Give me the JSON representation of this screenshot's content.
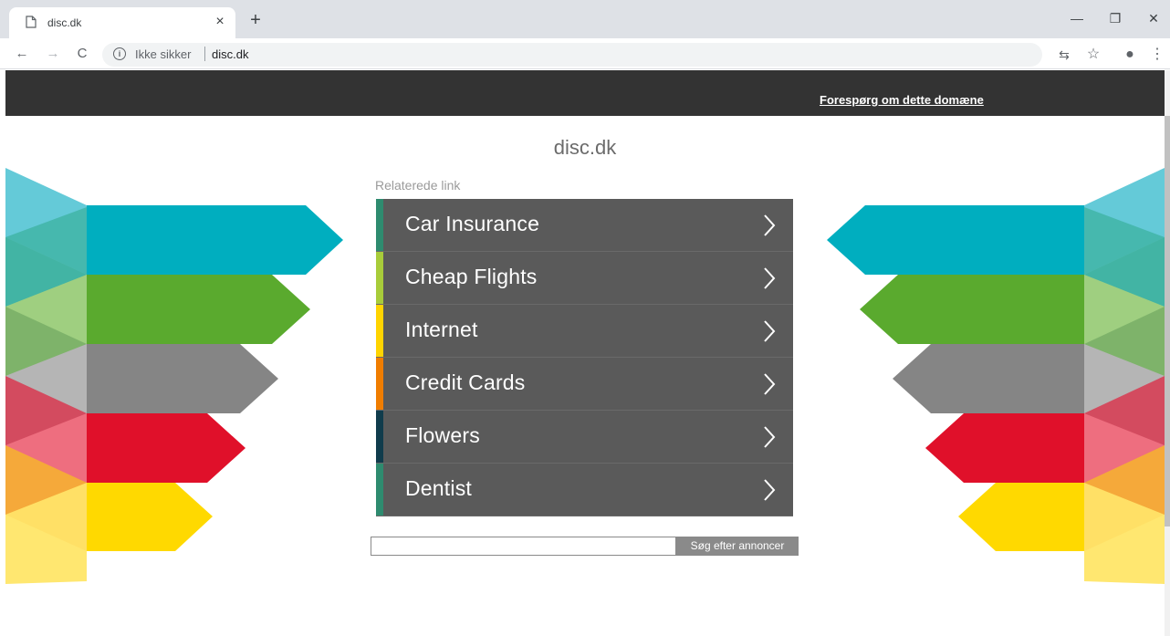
{
  "browser": {
    "tab_title": "disc.dk",
    "close_glyph": "×",
    "new_tab_glyph": "+",
    "minimize_glyph": "—",
    "restore_glyph": "❐",
    "window_close_glyph": "✕",
    "back_glyph": "←",
    "forward_glyph": "→",
    "reload_glyph": "C",
    "info_glyph": "i",
    "not_secure": "Ikke sikker",
    "url": "disc.dk",
    "translate_glyph": "⇆",
    "star_glyph": "☆",
    "account_glyph": "●",
    "menu_glyph": "⋮"
  },
  "header": {
    "inquire_link": "Forespørg om dette domæne"
  },
  "main": {
    "site_title": "disc.dk",
    "related_label": "Relaterede link",
    "links": [
      {
        "label": "Car Insurance",
        "accent": "#2e8b6f"
      },
      {
        "label": "Cheap Flights",
        "accent": "#a8cc3a"
      },
      {
        "label": "Internet",
        "accent": "#ffd400"
      },
      {
        "label": "Credit Cards",
        "accent": "#f07d00"
      },
      {
        "label": "Flowers",
        "accent": "#103c4c"
      },
      {
        "label": "Dentist",
        "accent": "#2e8b6f"
      }
    ],
    "search": {
      "value": "",
      "button_label": "Søg efter annoncer"
    }
  },
  "colors": {
    "teal": "#00aebf",
    "green": "#5aaa2e",
    "gray": "#858585",
    "red": "#e0102a",
    "yellow": "#ffd900",
    "dark_bar": "#333333",
    "link_bg": "#5a5a5a"
  }
}
